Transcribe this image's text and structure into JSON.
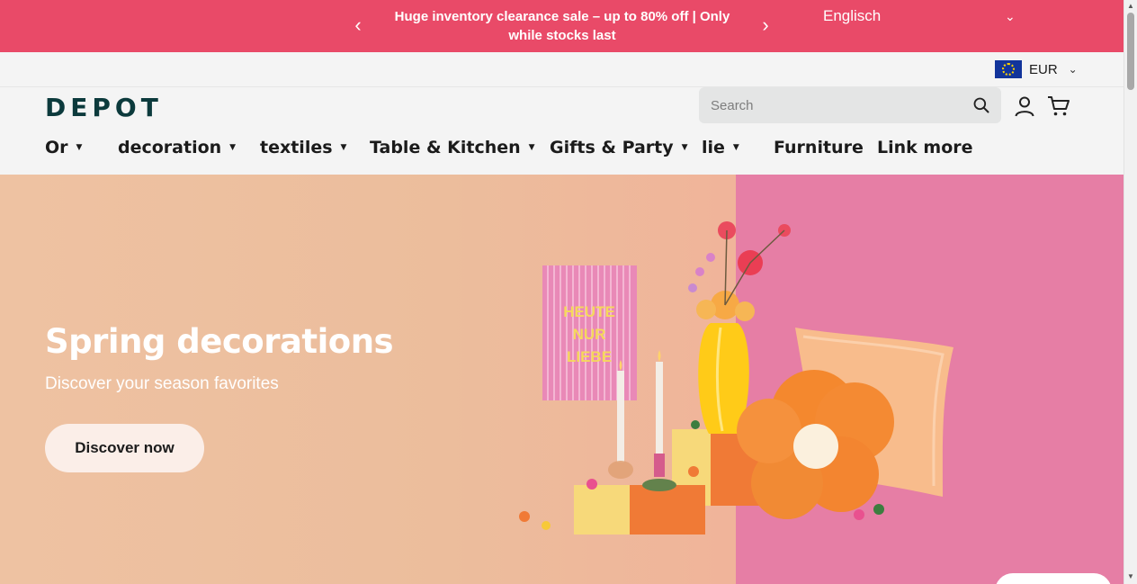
{
  "announcement": {
    "prev_arrow": "‹",
    "next_arrow": "›",
    "message": "Huge inventory clearance sale – up to 80% off | Only while stocks last",
    "language": "Englisch",
    "language_caret": "⌄"
  },
  "currency": {
    "code": "EUR",
    "caret": "⌄",
    "flag_icon": "eu-flag-icon"
  },
  "header": {
    "logo": "DEPOT",
    "search_placeholder": "Search",
    "icons": [
      "search-icon",
      "account-icon",
      "cart-icon"
    ]
  },
  "nav": [
    {
      "label": "Or",
      "dropdown": true
    },
    {
      "label": "decoration",
      "dropdown": true
    },
    {
      "label": "textiles",
      "dropdown": true
    },
    {
      "label": "Table & Kitchen",
      "dropdown": true
    },
    {
      "label": "Gifts & Party",
      "dropdown": true
    },
    {
      "label": "lie",
      "dropdown": true
    },
    {
      "label": "Furniture",
      "dropdown": false
    },
    {
      "label": "Link more",
      "dropdown": false
    }
  ],
  "nav_dropdown_glyph": "▼",
  "hero": {
    "title": "Spring decorations",
    "subtitle": "Discover your season favorites",
    "cta": "Discover now",
    "card_text": [
      "HEUTE",
      "NUR",
      "LIEBE"
    ]
  },
  "colors": {
    "announcement_bg": "#e94a68",
    "logo": "#0c3a3c",
    "hero_peach": "#ecbd9c",
    "hero_pink": "#e67ea5"
  }
}
